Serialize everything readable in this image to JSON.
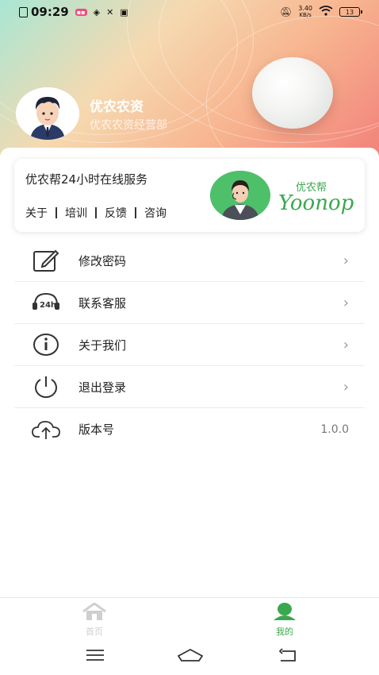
{
  "status_bar": {
    "time": "09:29",
    "net_speed_value": "3.40",
    "net_speed_unit": "KB/s",
    "battery": "13"
  },
  "profile": {
    "name": "优农农资",
    "subtitle": "优农农资经营部"
  },
  "service_card": {
    "title": "优农帮24小时在线服务",
    "links": [
      "关于",
      "培训",
      "反馈",
      "咨询"
    ],
    "brand_cn": "优农帮",
    "brand_en": "Yoonop",
    "brand_color": "#3aa84e"
  },
  "menu": {
    "items": [
      {
        "label": "修改密码",
        "icon": "edit-icon"
      },
      {
        "label": "联系客服",
        "icon": "headset-24h-icon"
      },
      {
        "label": "关于我们",
        "icon": "info-icon"
      },
      {
        "label": "退出登录",
        "icon": "power-icon"
      },
      {
        "label": "版本号",
        "icon": "cloud-upload-icon",
        "value": "1.0.0"
      }
    ]
  },
  "tabbar": {
    "home_label": "首页",
    "mine_label": "我的",
    "active_color": "#3aa84e",
    "inactive_color": "#cfcfcf"
  }
}
